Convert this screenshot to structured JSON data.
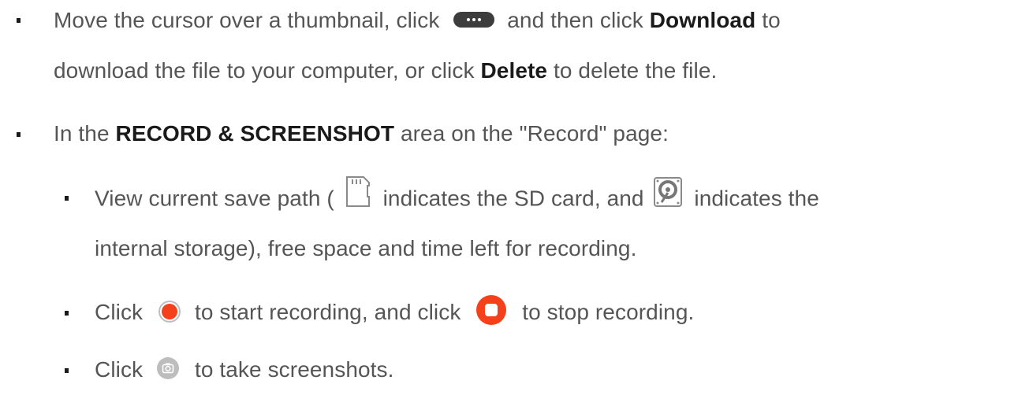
{
  "bullets": {
    "item1": {
      "part1": "Move the cursor over a thumbnail, click",
      "part2": "and then click",
      "download": "Download",
      "part3": "to",
      "line2_a": "download the file to your computer, or click",
      "delete": "Delete",
      "line2_b": "to delete the file."
    },
    "item2": {
      "part1": "In the",
      "area": "RECORD & SCREENSHOT",
      "part2": "area on the \"Record\" page:"
    },
    "sub1": {
      "part1": "View current save path (",
      "part2": "indicates the SD card, and",
      "part3": "indicates the",
      "line2": "internal storage), free space and time left for recording."
    },
    "sub2": {
      "part1": "Click",
      "part2": "to start recording, and click",
      "part3": "to stop recording."
    },
    "sub3": {
      "part1": "Click",
      "part2": "to take screenshots."
    }
  },
  "icons": {
    "more": "more-options-icon",
    "sd": "sd-card-icon",
    "hdd": "internal-storage-icon",
    "record": "record-icon",
    "stop": "stop-icon",
    "camera": "screenshot-camera-icon"
  },
  "colors": {
    "text": "#555555",
    "bold": "#1a1a1a",
    "record_red": "#f5401c",
    "icon_gray": "#bdbdbd"
  }
}
